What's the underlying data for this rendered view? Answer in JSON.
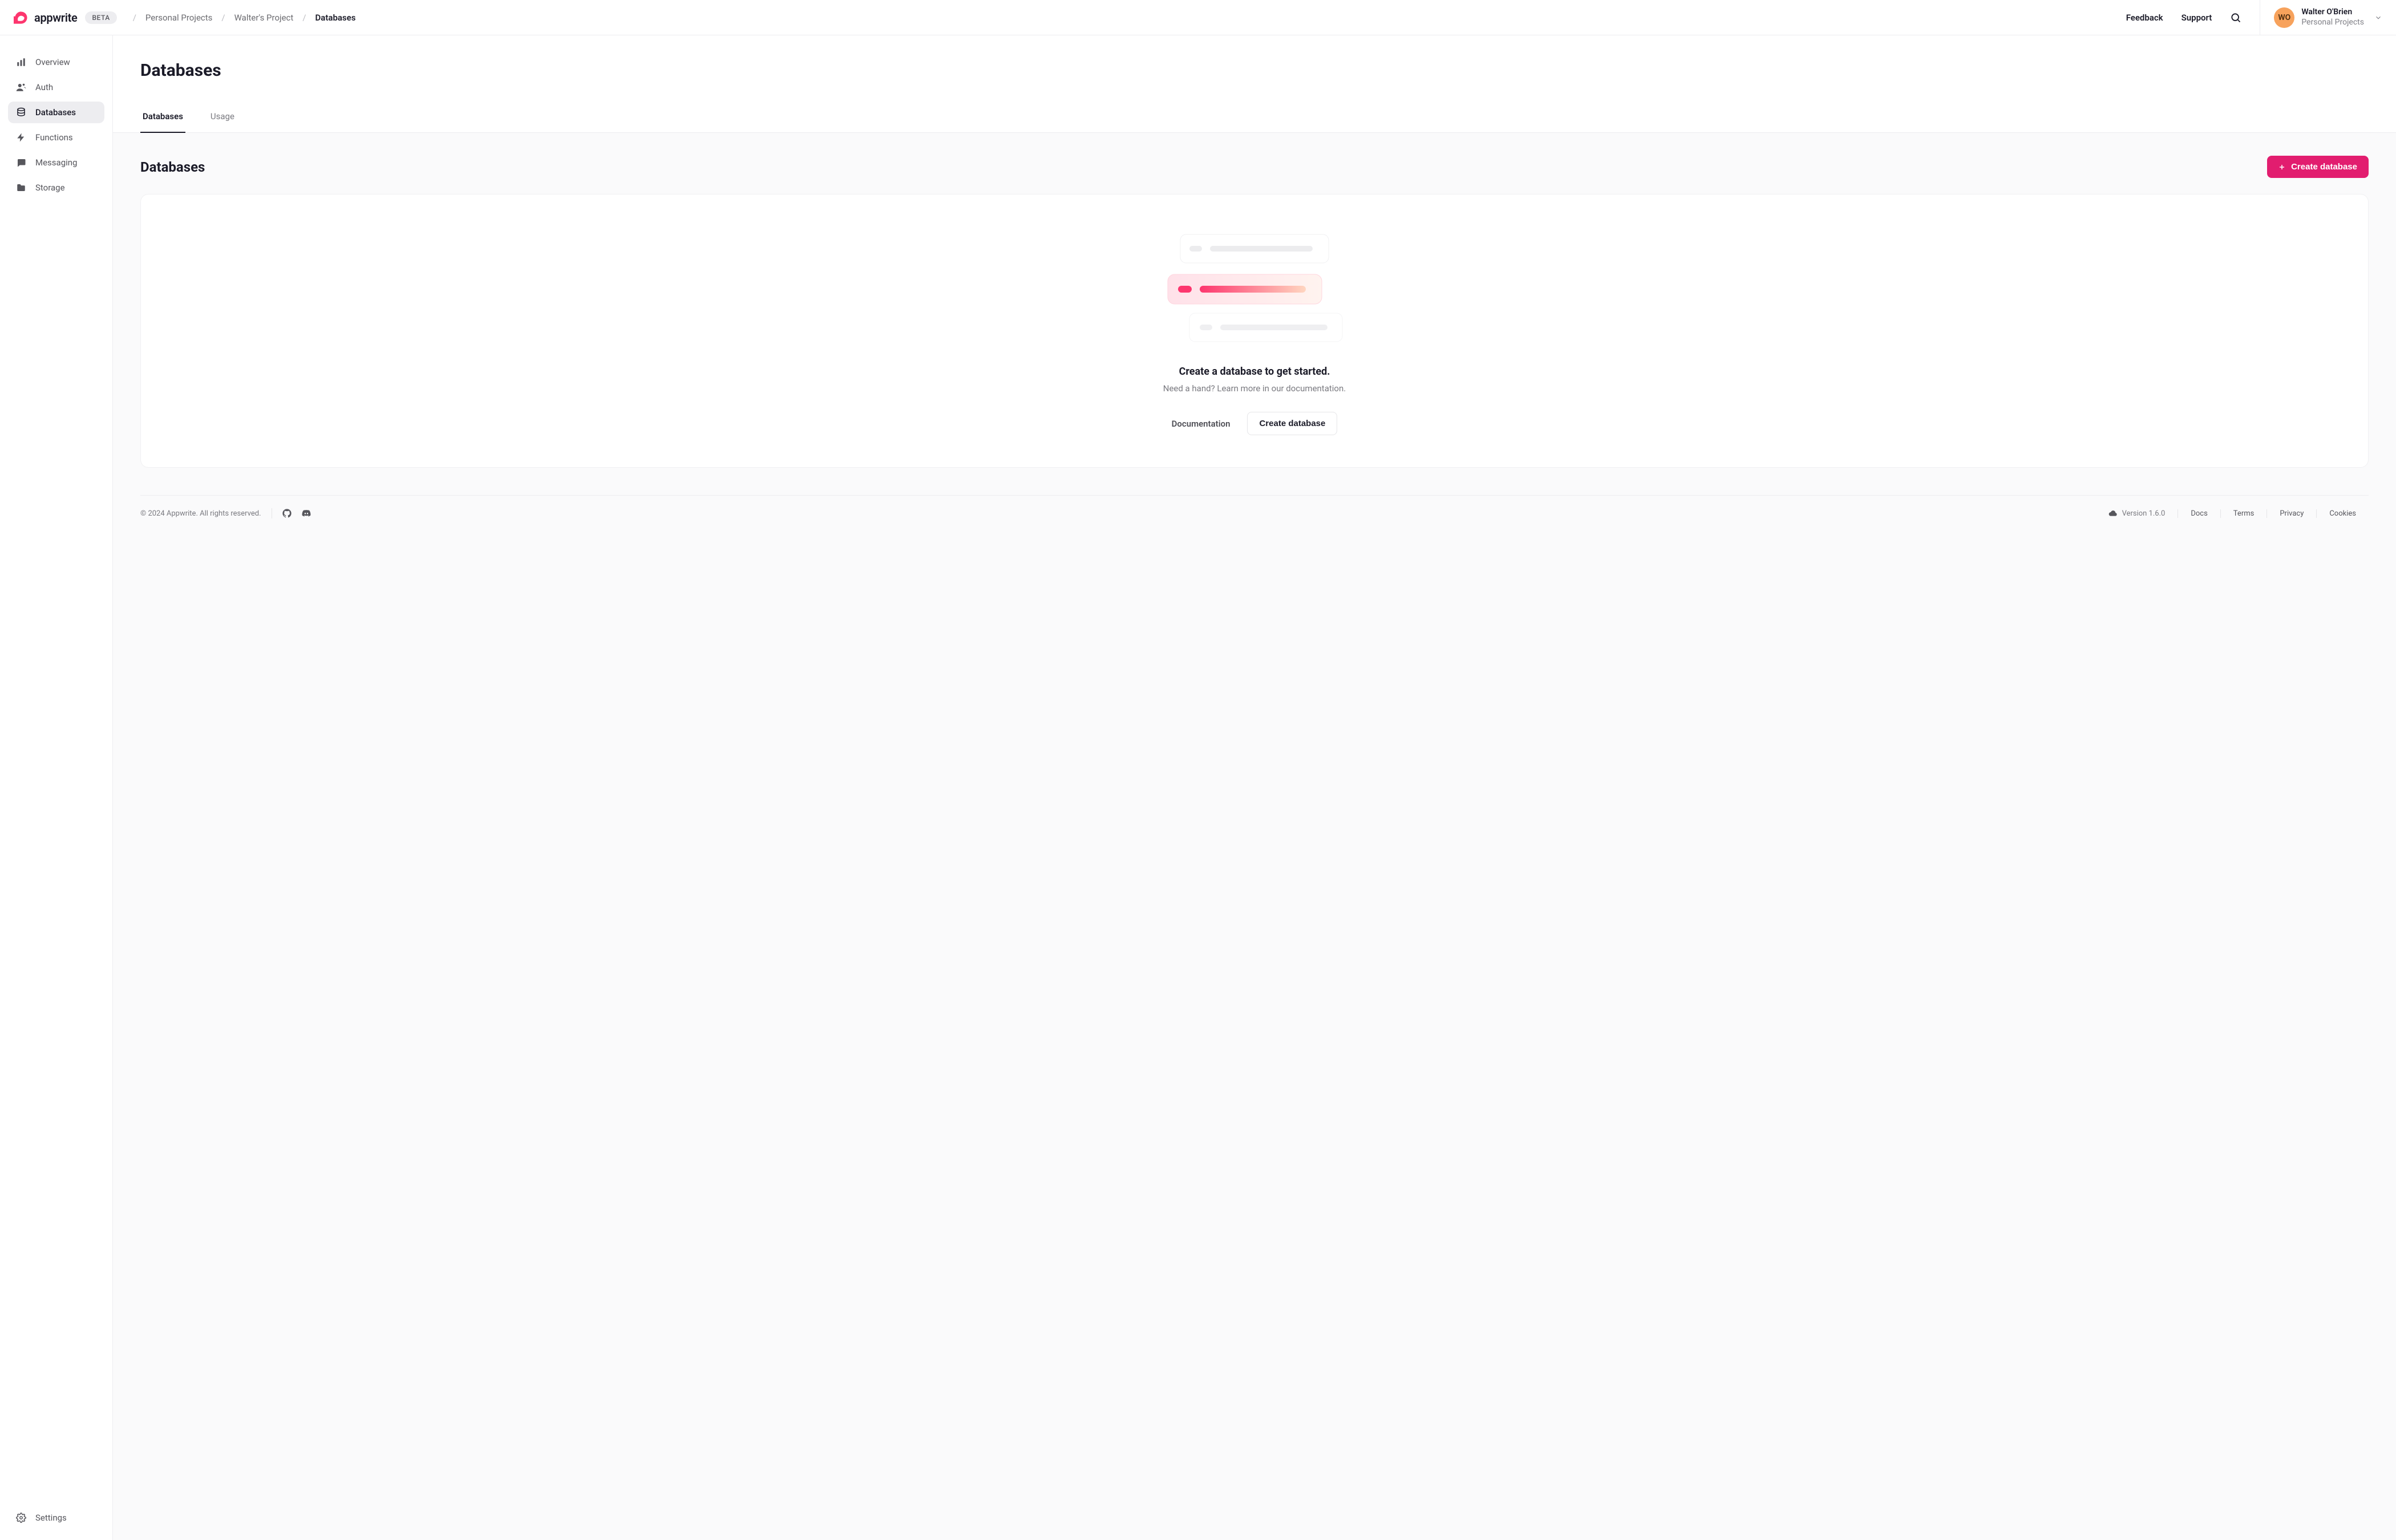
{
  "brand": {
    "name": "appwrite",
    "badge": "BETA"
  },
  "breadcrumbs": [
    {
      "label": "Personal Projects",
      "active": false
    },
    {
      "label": "Walter's Project",
      "active": false
    },
    {
      "label": "Databases",
      "active": true
    }
  ],
  "header": {
    "feedback": "Feedback",
    "support": "Support"
  },
  "account": {
    "initials": "WO",
    "name": "Walter O'Brien",
    "org": "Personal Projects"
  },
  "sidebar": {
    "items": [
      {
        "label": "Overview",
        "icon": "overview",
        "active": false
      },
      {
        "label": "Auth",
        "icon": "auth",
        "active": false
      },
      {
        "label": "Databases",
        "icon": "databases",
        "active": true
      },
      {
        "label": "Functions",
        "icon": "functions",
        "active": false
      },
      {
        "label": "Messaging",
        "icon": "messaging",
        "active": false
      },
      {
        "label": "Storage",
        "icon": "storage",
        "active": false
      }
    ],
    "settings_label": "Settings"
  },
  "page": {
    "title": "Databases",
    "tabs": [
      {
        "label": "Databases",
        "active": true
      },
      {
        "label": "Usage",
        "active": false
      }
    ],
    "section_title": "Databases",
    "create_button": "Create database",
    "empty": {
      "title": "Create a database to get started.",
      "subtitle": "Need a hand? Learn more in our documentation.",
      "doc_link": "Documentation",
      "create_button": "Create database"
    }
  },
  "footer": {
    "copyright": "© 2024 Appwrite. All rights reserved.",
    "version": "Version 1.6.0",
    "links": [
      "Docs",
      "Terms",
      "Privacy",
      "Cookies"
    ]
  }
}
